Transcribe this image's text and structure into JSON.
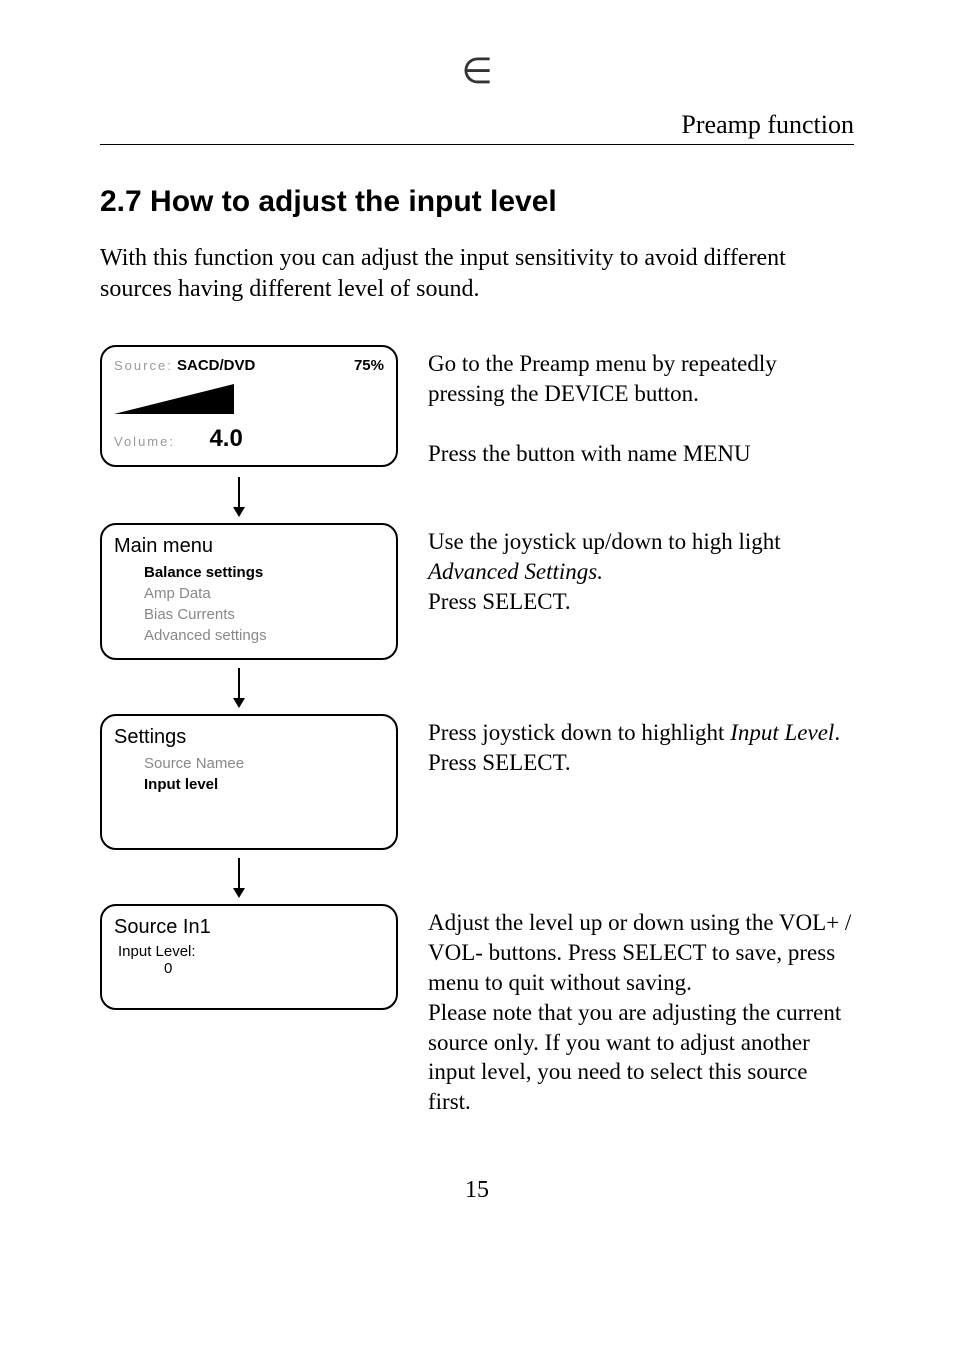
{
  "header": "Preamp function",
  "section_title": "2.7 How to adjust the input level",
  "intro": "With this function you can adjust the input sensitivity to avoid different sources having different level of sound.",
  "screen1": {
    "source_label": "Source:",
    "source_value": "SACD/DVD",
    "percent": "75%",
    "volume_label": "Volume:",
    "volume_value": "4.0"
  },
  "step1_a": "Go to the Preamp menu by repeatedly pressing the DEVICE button.",
  "step1_b": "Press the button with name MENU",
  "screen2": {
    "title": "Main menu",
    "items": [
      "Balance settings",
      "Amp Data",
      "Bias Currents",
      "Advanced settings"
    ]
  },
  "step2_a": "Use the joystick up/down to high light ",
  "step2_em": "Advanced Settings.",
  "step2_b": "Press SELECT.",
  "screen3": {
    "title": "Settings",
    "items": [
      "Source Namee",
      "Input level"
    ]
  },
  "step3_a": "Press joystick down to highlight ",
  "step3_em": "Input Level",
  "step3_b": ".",
  "step3_c": "Press SELECT.",
  "screen4": {
    "title": "Source In1",
    "label": "Input Level:",
    "value": "0"
  },
  "step4_a": "Adjust the level up or down using the VOL+ / VOL- buttons.  Press SELECT to save, press menu to quit without saving.",
  "step4_b": "Please note that you are adjusting the current source only.  If you want to adjust another input level, you need to select this source first.",
  "page_number": "15"
}
